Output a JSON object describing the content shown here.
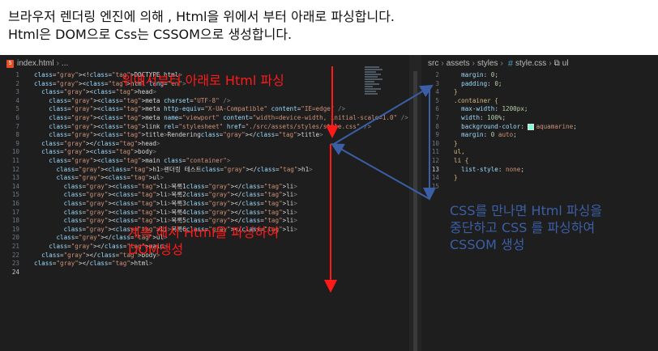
{
  "caption": {
    "line1": "브라우저 렌더링 엔진에 의해 , Html을 위에서 부터 아래로 파싱합니다.",
    "line2": "Html은 DOM으로 Css는 CSSOM으로 생성합니다."
  },
  "left_editor": {
    "breadcrumb": [
      "index.html",
      "..."
    ],
    "line_numbers": [
      "1",
      "2",
      "3",
      "4",
      "5",
      "6",
      "7",
      "8",
      "9",
      "10",
      "11",
      "12",
      "13",
      "14",
      "15",
      "16",
      "17",
      "18",
      "19",
      "20",
      "21",
      "22",
      "23",
      "24"
    ],
    "active_line": "24",
    "code_lines": [
      "<!DOCTYPE html>",
      "<html lang=\"en\">",
      "  <head>",
      "    <meta charset=\"UTF-8\" />",
      "    <meta http-equiv=\"X-UA-Compatible\" content=\"IE=edge\" />",
      "    <meta name=\"viewport\" content=\"width=device-width, initial-scale=1.0\" />",
      "    <link rel=\"stylesheet\" href=\"./src/assets/styles/style.css\" />",
      "    <title>Rendering</title>",
      "  </head>",
      "  <body>",
      "    <main class=\"container\">",
      "      <h1>렌더링 테스트</h1>",
      "      <ul>",
      "        <li>목록1</li>",
      "        <li>목록2</li>",
      "        <li>목록3</li>",
      "        <li>목록4</li>",
      "        <li>목록5</li>",
      "        <li>목록6</li>",
      "      </ul>",
      "    </main>",
      "  </body>",
      "</html>",
      ""
    ]
  },
  "right_editor": {
    "breadcrumb": [
      "src",
      "assets",
      "styles",
      "style.css",
      "ul"
    ],
    "line_numbers": [
      "2",
      "3",
      "4",
      "5",
      "6",
      "7",
      "8",
      "9",
      "10",
      "11",
      "12",
      "13",
      "14",
      "15"
    ],
    "active_line": "13",
    "code_lines": [
      "  margin: 0;",
      "  padding: 0;",
      "}",
      ".container {",
      "  max-width: 1200px;",
      "  width: 100%;",
      "  background-color: aquamarine;",
      "  margin: 0 auto;",
      "}",
      "ul,",
      "li {",
      "  list-style: none;",
      "}",
      ""
    ],
    "swatch_color": "#7fffd4"
  },
  "annotations": {
    "top_red": "위에서부터 아래로 Html 파싱",
    "bottom_red_line1": "계속 해서 Html을 파싱하여",
    "bottom_red_line2": "DOM생성",
    "blue_line1": "CSS를 만나면 Html 파싱을",
    "blue_line2": "중단하고 CSS 를 파싱하여",
    "blue_line3": "CSSOM 생성"
  },
  "colors": {
    "red": "#ff1a1a",
    "blue": "#3b5fa6",
    "editor_bg": "#1e1e1e"
  }
}
